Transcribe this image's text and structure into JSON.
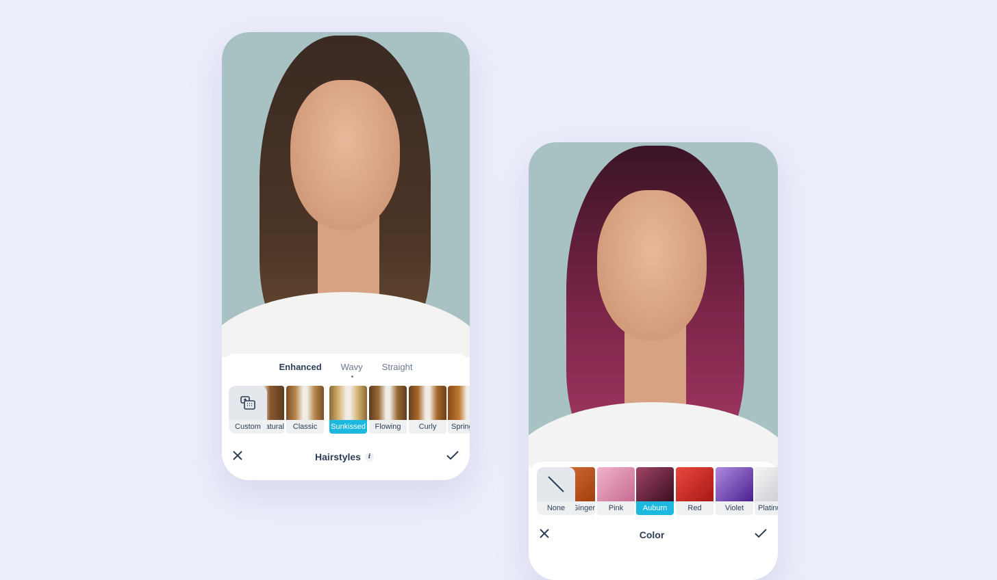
{
  "hairstyles": {
    "tabs": [
      {
        "label": "Enhanced",
        "active": true
      },
      {
        "label": "Wavy"
      },
      {
        "label": "Straight"
      }
    ],
    "items": [
      {
        "label": "Custom",
        "icon": "custom-style-icon"
      },
      {
        "label": "Natural"
      },
      {
        "label": "Classic"
      },
      {
        "label": "Sunkissed",
        "selected": true
      },
      {
        "label": "Flowing"
      },
      {
        "label": "Curly"
      },
      {
        "label": "Spring"
      }
    ],
    "title": "Hairstyles",
    "info": "i",
    "cancel_icon": "close-icon",
    "confirm_icon": "check-icon"
  },
  "color": {
    "items": [
      {
        "label": "None",
        "icon": "none-slash-icon"
      },
      {
        "label": "Ginger",
        "color": "#c0521e"
      },
      {
        "label": "Pink",
        "color": "#e29ab7"
      },
      {
        "label": "Auburn",
        "color": "#6e1f3c",
        "selected": true
      },
      {
        "label": "Red",
        "color": "#d42a26"
      },
      {
        "label": "Violet",
        "color": "#7a4fc0"
      },
      {
        "label": "Platinum",
        "color": "#e8e6ea"
      }
    ],
    "title": "Color",
    "cancel_icon": "close-icon",
    "confirm_icon": "check-icon"
  },
  "colors": {
    "accent": "#1db8e0",
    "background": "#eceefb",
    "text": "#2c3e55"
  }
}
